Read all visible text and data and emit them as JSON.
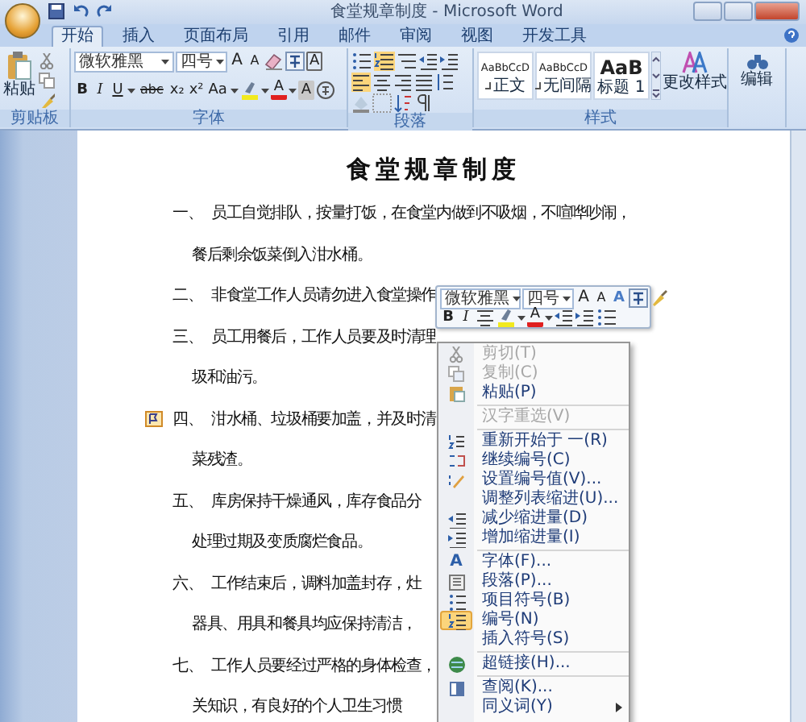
{
  "window": {
    "title": "食堂规章制度 - Microsoft Word"
  },
  "tabs": [
    {
      "label": "开始",
      "selected": true
    },
    {
      "label": "插入",
      "selected": false
    },
    {
      "label": "页面布局",
      "selected": false
    },
    {
      "label": "引用",
      "selected": false
    },
    {
      "label": "邮件",
      "selected": false
    },
    {
      "label": "审阅",
      "selected": false
    },
    {
      "label": "视图",
      "selected": false
    },
    {
      "label": "开发工具",
      "selected": false
    }
  ],
  "ribbon": {
    "clipboard": {
      "label": "剪贴板",
      "paste": "粘贴"
    },
    "font": {
      "label": "字体",
      "font_name": "微软雅黑",
      "font_size": "四号",
      "row1": [
        {
          "kind": "grow",
          "label": "A"
        },
        {
          "kind": "shrink",
          "label": "A"
        },
        {
          "kind": "clear"
        },
        {
          "kind": "phonetic"
        },
        {
          "kind": "border",
          "label": "A"
        }
      ],
      "row2": [
        {
          "kind": "bold",
          "label": "B"
        },
        {
          "kind": "italic",
          "label": "I"
        },
        {
          "kind": "underline",
          "label": "U"
        },
        {
          "kind": "strike",
          "label": "abc"
        },
        {
          "kind": "sub",
          "label": "x₂"
        },
        {
          "kind": "sup",
          "label": "x²"
        },
        {
          "kind": "case",
          "label": "Aa"
        },
        {
          "kind": "highlight"
        },
        {
          "kind": "color",
          "label": "A"
        },
        {
          "kind": "shading",
          "label": "A"
        },
        {
          "kind": "enclose"
        }
      ]
    },
    "paragraph": {
      "label": "段落",
      "numbering_on": true,
      "align_left_on": true
    },
    "styles": {
      "label": "样式",
      "items": [
        {
          "kind": "body",
          "preview": "AaBbCcD",
          "name": "正文"
        },
        {
          "kind": "body",
          "preview": "AaBbCcD",
          "name": "无间隔"
        },
        {
          "kind": "heading",
          "preview": "AaB",
          "name": "标题 1"
        }
      ],
      "change": "更改样式"
    },
    "editing": {
      "label": "编辑"
    }
  },
  "document": {
    "title": "食堂规章制度",
    "items": [
      {
        "number": "一、",
        "tag": false,
        "lines": [
          "员工自觉排队，按量打饭，在食堂内做到不吸烟，不喧哗吵闹，",
          "餐后剩余饭菜倒入泔水桶。"
        ]
      },
      {
        "number": "二、",
        "tag": false,
        "lines": [
          "非食堂工作人员请勿进入食堂操作"
        ]
      },
      {
        "number": "三、",
        "tag": false,
        "lines": [
          "员工用餐后，工作人员要及时清理",
          "圾和油污。"
        ]
      },
      {
        "number": "四、",
        "tag": true,
        "lines": [
          "泔水桶、垃圾桶要加盖，并及时清",
          "菜残渣。"
        ]
      },
      {
        "number": "五、",
        "tag": false,
        "lines": [
          "库房保持干燥通风，库存食品分",
          "处理过期及变质腐烂食品。"
        ]
      },
      {
        "number": "六、",
        "tag": false,
        "lines": [
          "工作结束后，调料加盖封存，灶",
          "器具、用具和餐具均应保持清洁，"
        ]
      },
      {
        "number": "七、",
        "tag": false,
        "lines": [
          "工作人员要经过严格的身体检查，",
          "关知识，有良好的个人卫生习惯"
        ]
      }
    ]
  },
  "mini_toolbar": {
    "font_name": "微软雅黑",
    "font_size": "四号",
    "row1": [
      {
        "kind": "grow",
        "label": "A"
      },
      {
        "kind": "shrink",
        "label": "A"
      },
      {
        "kind": "style",
        "label": "A"
      },
      {
        "kind": "phonetic"
      },
      {
        "kind": "painter"
      }
    ],
    "row2": [
      {
        "kind": "bold",
        "label": "B"
      },
      {
        "kind": "italic",
        "label": "I"
      },
      {
        "kind": "center"
      },
      {
        "kind": "highlight"
      },
      {
        "kind": "color",
        "label": "A"
      },
      {
        "kind": "outdent"
      },
      {
        "kind": "indent"
      },
      {
        "kind": "bullets"
      }
    ]
  },
  "context_menu": {
    "items": [
      {
        "kind": "item",
        "label": "剪切(T)",
        "disabled": true,
        "checked": false,
        "submenu": false
      },
      {
        "kind": "item",
        "label": "复制(C)",
        "disabled": true,
        "checked": false,
        "submenu": false
      },
      {
        "kind": "item",
        "label": "粘贴(P)",
        "disabled": false,
        "checked": false,
        "submenu": false
      },
      {
        "kind": "separator"
      },
      {
        "kind": "item",
        "label": "汉字重选(V)",
        "disabled": true,
        "checked": false,
        "submenu": false
      },
      {
        "kind": "separator"
      },
      {
        "kind": "item",
        "label": "重新开始于 一(R)",
        "disabled": false,
        "checked": false,
        "submenu": false
      },
      {
        "kind": "item",
        "label": "继续编号(C)",
        "disabled": false,
        "checked": false,
        "submenu": false
      },
      {
        "kind": "item",
        "label": "设置编号值(V)...",
        "disabled": false,
        "checked": false,
        "submenu": false
      },
      {
        "kind": "item",
        "label": "调整列表缩进(U)...",
        "disabled": false,
        "checked": false,
        "submenu": false
      },
      {
        "kind": "item",
        "label": "减少缩进量(D)",
        "disabled": false,
        "checked": false,
        "submenu": false
      },
      {
        "kind": "item",
        "label": "增加缩进量(I)",
        "disabled": false,
        "checked": false,
        "submenu": false
      },
      {
        "kind": "separator"
      },
      {
        "kind": "item",
        "label": "字体(F)...",
        "glyph": "A",
        "disabled": false,
        "checked": false,
        "submenu": false
      },
      {
        "kind": "item",
        "label": "段落(P)...",
        "disabled": false,
        "checked": false,
        "submenu": false
      },
      {
        "kind": "item",
        "label": "项目符号(B)",
        "disabled": false,
        "checked": false,
        "submenu": false
      },
      {
        "kind": "item",
        "label": "编号(N)",
        "disabled": false,
        "checked": true,
        "submenu": false
      },
      {
        "kind": "item",
        "label": "插入符号(S)",
        "disabled": false,
        "checked": false,
        "submenu": false
      },
      {
        "kind": "separator"
      },
      {
        "kind": "item",
        "label": "超链接(H)...",
        "disabled": false,
        "checked": false,
        "submenu": false
      },
      {
        "kind": "separator"
      },
      {
        "kind": "item",
        "label": "查阅(K)...",
        "disabled": false,
        "checked": false,
        "submenu": false
      },
      {
        "kind": "item",
        "label": "同义词(Y)",
        "disabled": false,
        "checked": false,
        "submenu": true
      }
    ]
  }
}
